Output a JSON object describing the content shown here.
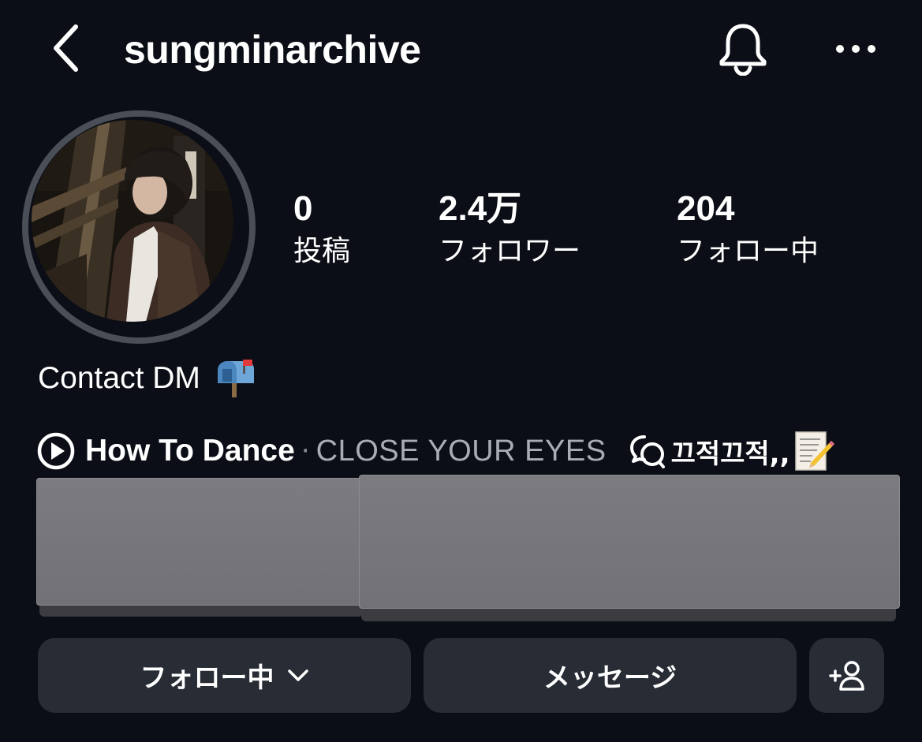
{
  "header": {
    "username": "sungminarchive",
    "back_icon": "chevron-left-icon",
    "bell_icon": "bell-icon",
    "more_icon": "more-horizontal-icon"
  },
  "stats": [
    {
      "count": "0",
      "label": "投稿"
    },
    {
      "count": "2.4万",
      "label": "フォロワー"
    },
    {
      "count": "204",
      "label": "フォロー中"
    }
  ],
  "bio": {
    "text": "Contact DM",
    "emoji_icon": "mailbox-icon"
  },
  "music": {
    "title": "How To Dance",
    "separator": "·",
    "artist": "CLOSE YOUR EYES",
    "play_icon": "play-circle-icon"
  },
  "thread": {
    "text": "끄적끄적,,",
    "icon": "threads-icon",
    "emoji_icon": "memo-icon"
  },
  "actions": {
    "following_label": "フォロー中",
    "message_label": "メッセージ",
    "suggest_icon": "add-person-icon"
  },
  "colors": {
    "background": "#0b0e16",
    "button_bg": "#272c35",
    "avatar_ring": "#4a4e57",
    "muted_text": "#a8adb5",
    "redaction_block": "#77777b"
  }
}
